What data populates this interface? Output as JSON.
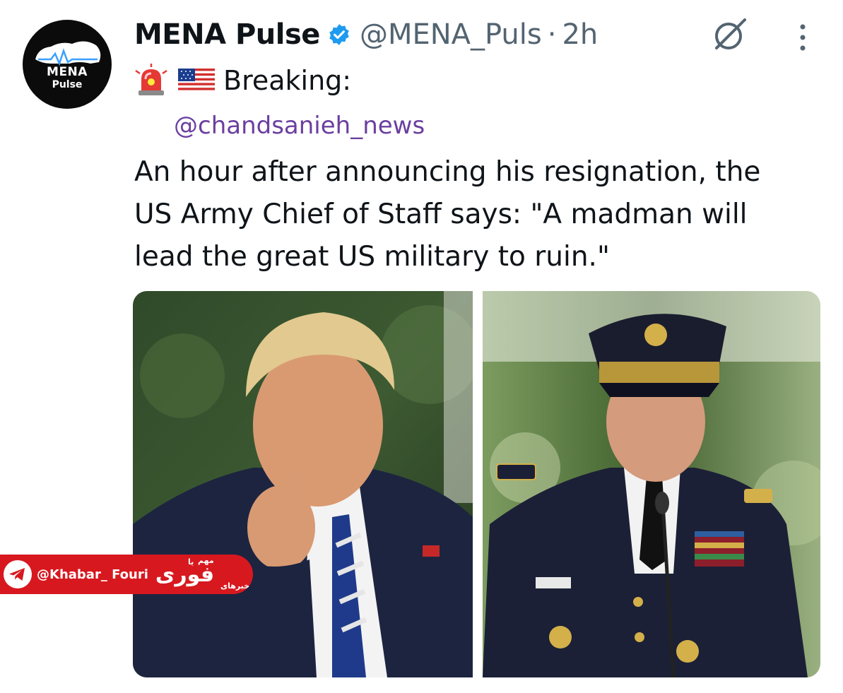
{
  "avatar": {
    "line1": "MENA",
    "line2": "Pulse"
  },
  "author": {
    "name": "MENA Pulse",
    "handle": "@MENA_Puls",
    "separator": "·",
    "time": "2h"
  },
  "icons": {
    "verified": "verified-badge-icon",
    "grok": "grok-icon",
    "more": "more-options-icon",
    "siren": "rotating-light-emoji",
    "flag": "us-flag-emoji",
    "telegram": "telegram-icon"
  },
  "breaking_label": "Breaking:",
  "mention": "@chandsanieh_news",
  "tweet_lines": [
    "An hour after announcing his resignation, the",
    "US Army Chief of Staff says: \"A madman will",
    "lead the great US military to ruin.\""
  ],
  "watermark": {
    "handle": "@Khabar_ Fouri",
    "logo_text": "فوری",
    "logo_small_top": "مهم",
    "logo_small_left": "یا",
    "logo_small_bottom": "خبرهای"
  },
  "colors": {
    "verified_blue": "#1d9bf0",
    "mention_purple": "#6b3fa0",
    "watermark_red": "#d7181f",
    "secondary_text": "#536471"
  }
}
